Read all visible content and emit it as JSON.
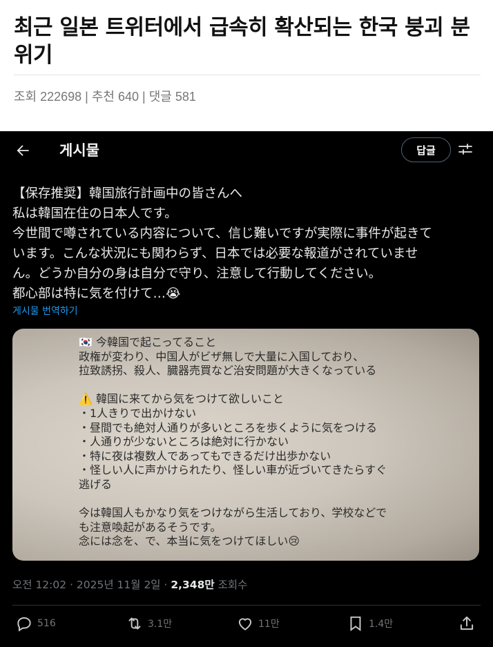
{
  "article": {
    "title": "최근 일본 트위터에서 급속히 확산되는 한국 붕괴 분위기",
    "meta": "조회 222698 | 추천 640 | 댓글 581"
  },
  "tweet": {
    "topbar_title": "게시물",
    "reply_label": "답글",
    "text": "【保存推奨】韓国旅行計画中の皆さんへ\n私は韓国在住の日本人です。\n今世間で噂されている内容について、信じ難いですが実際に事件が起きて\nいます。こんな状況にも関わらず、日本では必要な報道がされていませ\nん。どうか自分の身は自分で守り、注意して行動してください。\n都心部は特に気を付けて…😭",
    "translate_label": "게시물 번역하기",
    "media_text": "🇰🇷 今韓国で起こってること\n政権が変わり、中国人がビザ無しで大量に入国しており、\n拉致誘拐、殺人、臓器売買など治安問題が大きくなっている\n\n⚠️ 韓国に来てから気をつけて欲しいこと\n・1人きりで出かけない\n・昼間でも絶対人通りが多いところを歩くように気をつける\n・人通りが少ないところは絶対に行かない\n・特に夜は複数人であってもできるだけ出歩かない\n・怪しい人に声かけられたり、怪しい車が近づいてきたらすぐ\n逃げる\n\n今は韓国人もかなり気をつけながら生活しており、学校などで\nも注意喚起があるそうです。\n念には念を、で、本当に気をつけてほしい😢",
    "timestamp_prefix": "오전 12:02 · 2025년 11월 2일 · ",
    "views_count": "2,348만",
    "views_label": " 조회수",
    "actions": {
      "replies": "516",
      "retweets": "3.1만",
      "likes": "11만",
      "bookmarks": "1.4만"
    }
  },
  "icons": [
    "back-arrow-icon",
    "filter-icon",
    "reply-icon",
    "retweet-icon",
    "like-icon",
    "bookmark-icon",
    "share-icon"
  ],
  "colors": {
    "tweet_bg": "#000000",
    "link": "#1d9bf0",
    "muted": "#71767b"
  }
}
